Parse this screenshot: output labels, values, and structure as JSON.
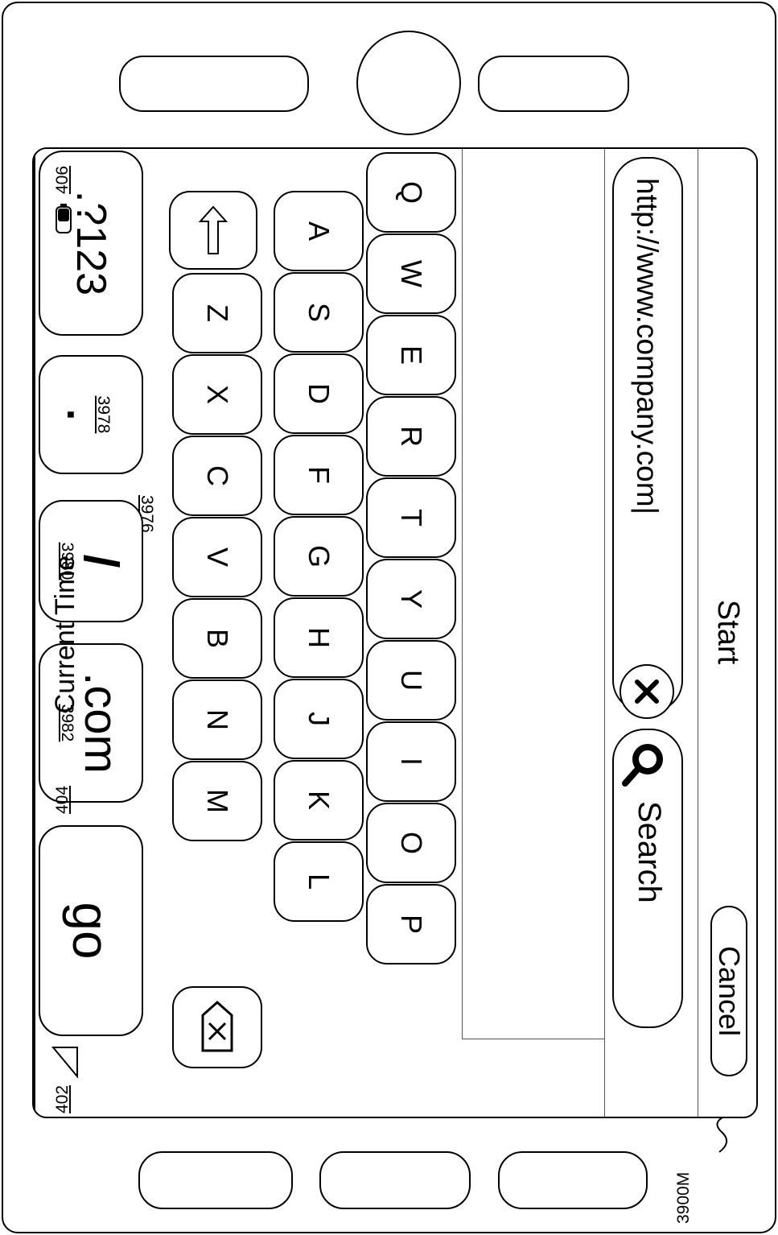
{
  "browser": {
    "title": "Start",
    "cancel_label": "Cancel",
    "url_value": "http://www.company.com|",
    "search_label": "Search"
  },
  "status_bar": {
    "time": "Current Time",
    "ref_signal": "402",
    "ref_time": "404",
    "ref_battery": "406"
  },
  "keyboard": {
    "row1": [
      "Q",
      "W",
      "E",
      "R",
      "T",
      "Y",
      "U",
      "I",
      "O",
      "P"
    ],
    "row2": [
      "A",
      "S",
      "D",
      "F",
      "G",
      "H",
      "J",
      "K",
      "L"
    ],
    "row3": [
      "Z",
      "X",
      "C",
      "V",
      "B",
      "N",
      "M"
    ],
    "numbers_label": ".?123",
    "period_label": ".",
    "period_ref": "3978",
    "slash_label": "/",
    "slash_ref": "3980",
    "dotcom_label": ".com",
    "dotcom_ref": "3982",
    "go_label": "go",
    "keyboard_ref": "3976",
    "icons": {
      "shift": "shift-arrow-icon",
      "backspace": "backspace-icon"
    }
  },
  "device": {
    "ref_label": "3900M"
  }
}
